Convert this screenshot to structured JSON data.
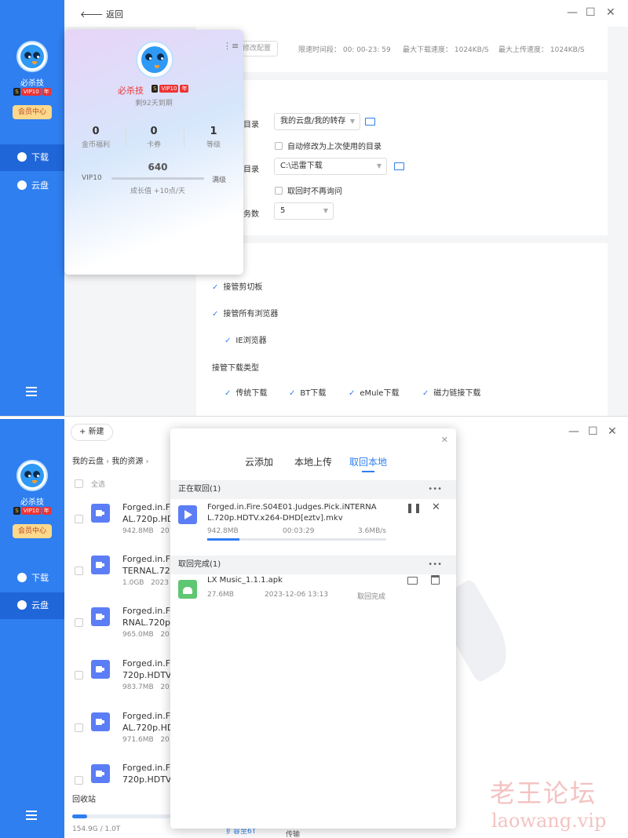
{
  "top": {
    "back_label": "返回",
    "user": {
      "name": "必杀技",
      "badge_s": "S",
      "badge_vip": "VIP10",
      "badge_year": "年",
      "vip_center": "会员中心"
    },
    "nav": {
      "download": "下载",
      "cloud": "云盘"
    },
    "toolbar": {
      "change_config": "修改配置",
      "limit_time": "限速时间段： 00: 00-23: 59",
      "max_download": "最大下载速度： 1024KB/S",
      "max_upload": "最大上传速度： 1024KB/S"
    },
    "settings": {
      "save_dir_label": "目录",
      "save_dir_value": "我的云盘/我的转存",
      "auto_modify": "自动修改为上次使用的目录",
      "local_dir_label": "目录",
      "local_dir_value": "C:\\迅雷下载",
      "no_ask": "取回时不再询问",
      "tasks_label": "任务数",
      "tasks_value": "5"
    },
    "takeover": {
      "clipboard": "接管剪切板",
      "all_browsers": "接管所有浏览器",
      "ie": "IE浏览器",
      "types_label": "接管下载类型",
      "types": [
        "传统下载",
        "BT下载",
        "eMule下载",
        "磁力链接下载"
      ]
    },
    "popup": {
      "name": "必杀技",
      "expire": "剩92天到期",
      "stats": [
        {
          "value": "0",
          "label": "金币福利"
        },
        {
          "value": "0",
          "label": "卡券"
        },
        {
          "value": "1",
          "label": "等级"
        }
      ],
      "vip_level": "VIP10",
      "growth_value": "640",
      "growth_full": "满级",
      "growth_rate": "成长值 +10点/天",
      "growth_progress": 1.0
    }
  },
  "bottom": {
    "new_label": "新建",
    "breadcrumb": [
      "我的云盘",
      "我的资源"
    ],
    "select_all": "全选",
    "files": [
      {
        "name": [
          "Forged.in.Fi",
          "AL.720p.HD"
        ],
        "size": "942.8MB",
        "date": "20"
      },
      {
        "name": [
          "Forged.in.Fi",
          "TERNAL.720"
        ],
        "size": "1.0GB",
        "date": "2023"
      },
      {
        "name": [
          "Forged.in.Fi",
          "RNAL.720p."
        ],
        "size": "965.0MB",
        "date": "20"
      },
      {
        "name": [
          "Forged.in.Fi",
          "720p.HDTV."
        ],
        "size": "983.7MB",
        "date": "20"
      },
      {
        "name": [
          "Forged.in.Fi",
          "AL.720p.HD"
        ],
        "size": "971.6MB",
        "date": "20"
      },
      {
        "name": [
          "Forged.in.Fi",
          "720p.HDTV."
        ],
        "size": "",
        "date": ""
      }
    ],
    "recycle": "回收站",
    "storage": "154.9G / 1.0T",
    "storage_ratio": 0.15,
    "expand_link": "扩容至6T",
    "transfer_tab": "传输",
    "dialog": {
      "tabs": [
        "云添加",
        "本地上传",
        "取回本地"
      ],
      "active_tab": 2,
      "retrieving_header": "正在取回(1)",
      "retrieving": {
        "name": [
          "Forged.in.Fire.S04E01.Judges.Pick.iNTERNA",
          "L.720p.HDTV.x264-DHD[eztv].mkv"
        ],
        "size": "942.8MB",
        "time": "00:03:29",
        "speed": "3.6MB/s",
        "progress": 0.18
      },
      "done_header": "取回完成(1)",
      "done": {
        "name": "LX Music_1.1.1.apk",
        "size": "27.6MB",
        "date": "2023-12-06 13:13",
        "status": "取回完成"
      }
    }
  },
  "watermark": {
    "title": "老王论坛",
    "url": "laowang.vip"
  },
  "colors": {
    "accent": "#2f7ff0",
    "sidebar": "#2f7ff0",
    "watermark": "#e67878"
  }
}
